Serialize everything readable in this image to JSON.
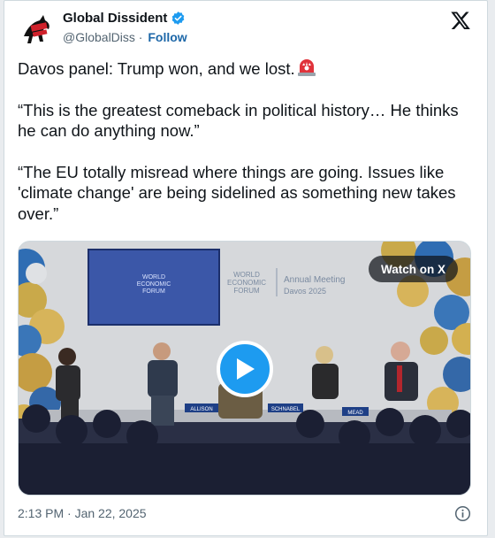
{
  "author": {
    "display_name": "Global Dissident",
    "handle": "@GlobalDiss",
    "follow_label": "Follow",
    "avatar_icon": "horse-logo-avatar",
    "verified_icon": "verified-badge-icon"
  },
  "platform_icon": "x-logo-icon",
  "tweet": {
    "line1": "Davos panel: Trump won, and we lost.",
    "line1_emoji": "police-siren-icon",
    "paragraph2": "“This is the greatest comeback in political history… He thinks he can do anything now.”",
    "paragraph3": "“The EU totally misread where things are going. Issues like 'climate change' are being sidelined as something new takes over.”"
  },
  "media": {
    "watch_label": "Watch on X",
    "play_icon": "play-icon",
    "screen_logo_lines": [
      "WORLD",
      "ECONOMIC",
      "FORUM"
    ],
    "backdrop_logo_lines": [
      "WORLD",
      "ECONOMIC",
      "FORUM"
    ],
    "backdrop_title": "Annual Meeting",
    "backdrop_subtitle": "Davos 2025",
    "name_cards": [
      "ALLISON",
      "SCHNABEL",
      "MEAD"
    ]
  },
  "footer": {
    "timestamp": "2:13 PM · Jan 22, 2025",
    "info_icon": "info-icon"
  },
  "colors": {
    "follow_blue": "#1d67a8",
    "verified_blue": "#1d9bf0",
    "play_blue": "#1d9bf0",
    "text_primary": "#0f1419",
    "text_secondary": "#536471"
  }
}
